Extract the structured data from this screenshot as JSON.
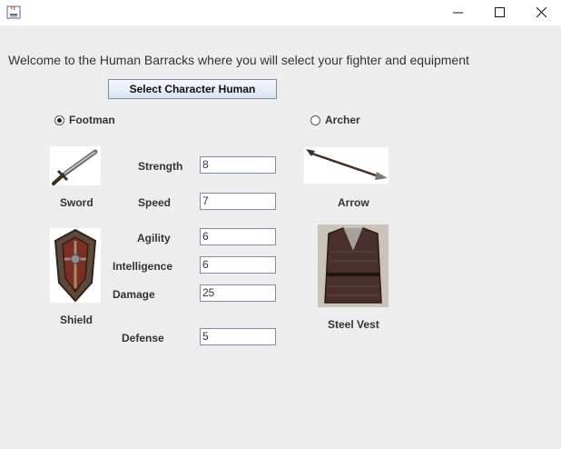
{
  "window": {
    "app_icon": "java-icon",
    "controls": {
      "minimize": "minimize-icon",
      "maximize": "maximize-icon",
      "close": "close-icon"
    }
  },
  "welcome_text": "Welcome to the Human Barracks where you will select your fighter and equipment",
  "select_button_label": "Select Character Human",
  "radios": [
    {
      "label": "Footman",
      "checked": true
    },
    {
      "label": "Archer",
      "checked": false
    }
  ],
  "equipment": {
    "sword": "Sword",
    "shield": "Shield",
    "arrow": "Arrow",
    "steel_vest": "Steel Vest"
  },
  "stats": {
    "strength": {
      "label": "Strength",
      "value": "8"
    },
    "speed": {
      "label": "Speed",
      "value": "7"
    },
    "agility": {
      "label": "Agility",
      "value": "6"
    },
    "intelligence": {
      "label": "Intelligence",
      "value": "6"
    },
    "damage": {
      "label": "Damage",
      "value": "25"
    },
    "defense": {
      "label": "Defense",
      "value": "5"
    }
  }
}
